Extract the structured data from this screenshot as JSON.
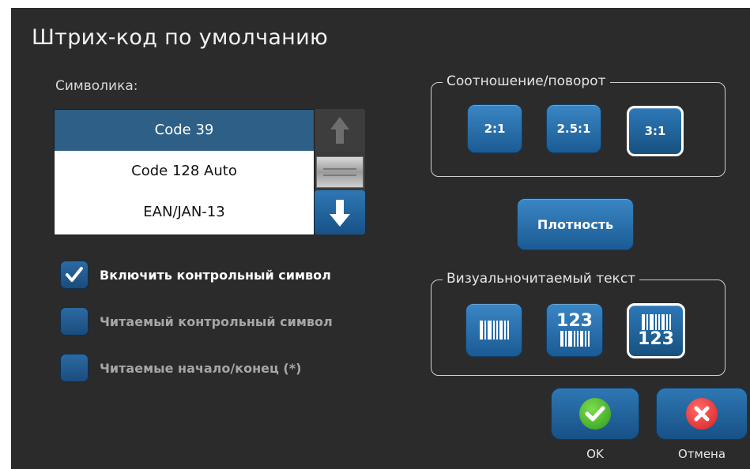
{
  "dialog": {
    "title": "Штрих-код по умолчанию"
  },
  "symbology": {
    "label": "Символика:",
    "items": [
      "Code 39",
      "Code 128 Auto",
      "EAN/JAN-13"
    ],
    "selected": "Code 39"
  },
  "scrollbar": {
    "up_icon": "arrow-up-icon",
    "down_icon": "arrow-down-icon"
  },
  "options": [
    {
      "label": "Включить контрольный символ",
      "checked": true
    },
    {
      "label": "Читаемый контрольный символ",
      "checked": false
    },
    {
      "label": "Читаемые начало/конец (*)",
      "checked": false
    }
  ],
  "ratio": {
    "title": "Соотношение/поворот",
    "buttons": [
      "2:1",
      "2.5:1",
      "3:1"
    ],
    "selected": "3:1"
  },
  "density": {
    "label": "Плотность"
  },
  "hri": {
    "title": "Визуальночитаемый текст",
    "buttons": [
      {
        "icon": "barcode-no-text-icon",
        "selected": false
      },
      {
        "icon": "barcode-text-above-icon",
        "text": "123",
        "selected": false
      },
      {
        "icon": "barcode-text-below-icon",
        "text": "123",
        "selected": true
      }
    ]
  },
  "actions": {
    "ok": "OK",
    "cancel": "Отмена"
  },
  "colors": {
    "background": "#2b2b2b",
    "button_blue": "#2a6fae",
    "selected_row": "#2e5f86",
    "ok_green": "#43b02a",
    "cancel_red": "#e03030"
  }
}
